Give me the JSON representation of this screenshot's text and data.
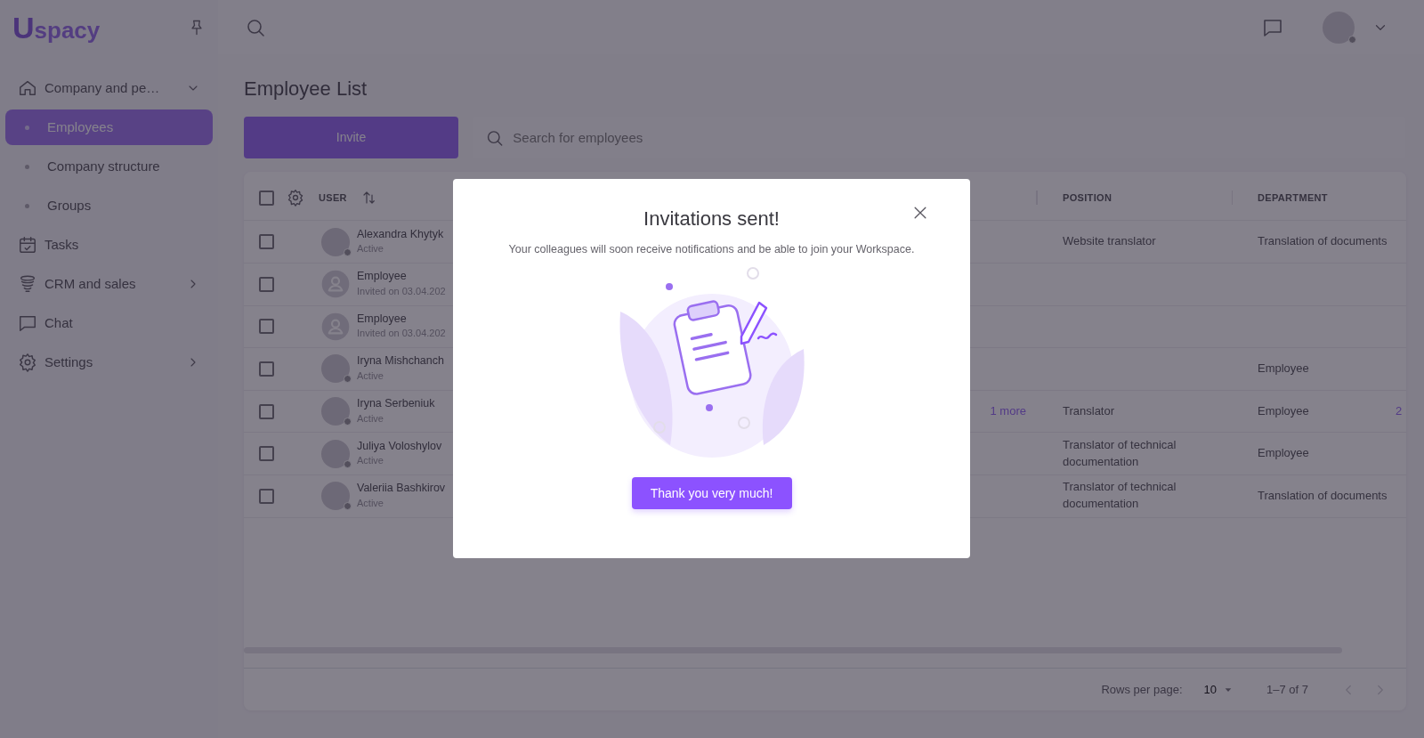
{
  "logo": {
    "mark": "U",
    "text": "spacy"
  },
  "sidebar": {
    "items": [
      {
        "label": "Company and pe…",
        "selected": false,
        "expanded": true,
        "children": [
          {
            "label": "Employees",
            "selected": true
          },
          {
            "label": "Company structure",
            "selected": false
          },
          {
            "label": "Groups",
            "selected": false
          }
        ]
      },
      {
        "label": "Tasks",
        "selected": false
      },
      {
        "label": "CRM and sales",
        "selected": false,
        "expanded": false
      },
      {
        "label": "Chat",
        "selected": false
      },
      {
        "label": "Settings",
        "selected": false,
        "expanded": false
      }
    ]
  },
  "page": {
    "title": "Employee List",
    "invite_button": "Invite",
    "search": {
      "placeholder": "Search for employees"
    }
  },
  "table": {
    "select_all_checked": false,
    "columns": [
      "USER",
      "POSITION",
      "DEPARTMENT"
    ],
    "rows": [
      {
        "kind": "member",
        "checked": false,
        "name": "Alexandra Khytyk",
        "status": "Active",
        "position": "Website translator",
        "department": "Translation of documents"
      },
      {
        "kind": "invited",
        "checked": false,
        "name": "Employee",
        "status": "Invited on 03.04.202"
      },
      {
        "kind": "invited",
        "checked": false,
        "name": "Employee",
        "status": "Invited on 03.04.202"
      },
      {
        "kind": "member",
        "checked": false,
        "name": "Iryna Mishchanch",
        "status": "Active",
        "department": "Employee"
      },
      {
        "kind": "member",
        "checked": false,
        "name": "Iryna Serbeniuk",
        "status": "Active",
        "column_3": "1 more",
        "position": "Translator",
        "department": "Employee",
        "column_7": "2"
      },
      {
        "kind": "member",
        "checked": false,
        "name": "Juliya Voloshylov",
        "status": "Active",
        "position": "Translator of technical documentation",
        "department": "Employee"
      },
      {
        "kind": "member",
        "checked": false,
        "name": "Valeriia Bashkirov",
        "status": "Active",
        "position": "Translator of technical documentation",
        "department": "Translation of documents"
      }
    ]
  },
  "pagination": {
    "rows_per_page_label": "Rows per page:",
    "rows_per_page": "10",
    "range": "1–7 of 7"
  },
  "modal": {
    "title": "Invitations sent!",
    "message": "Your colleagues will soon receive notifications and be able to join your Workspace.",
    "button": "Thank you very much!"
  }
}
